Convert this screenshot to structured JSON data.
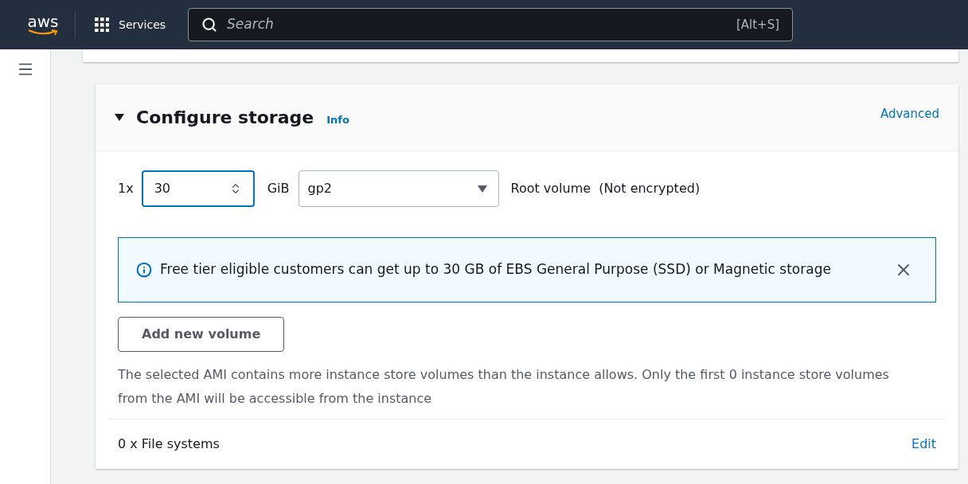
{
  "top_nav": {
    "logo": "aws",
    "services": "Services",
    "search": {
      "placeholder": "Search",
      "shortcut": "[Alt+S]"
    }
  },
  "section": {
    "title": "Configure storage",
    "expanded": true,
    "info": "Info",
    "advanced": "Advanced",
    "volume": {
      "count": "1x",
      "size": "30",
      "focused": true,
      "unit": "GiB",
      "type": "gp2",
      "description": "Root volume  (Not encrypted)"
    },
    "alert": {
      "text": "Free tier eligible customers can get up to 30 GB of EBS General Purpose (SSD) or Magnetic storage"
    },
    "add_button": "Add new volume",
    "note": "The selected AMI contains more instance store volumes than the instance allows. Only the first 0 instance store volumes from the AMI will be accessible from the instance",
    "file_systems": {
      "label": "0 x File systems",
      "edit": "Edit"
    }
  }
}
